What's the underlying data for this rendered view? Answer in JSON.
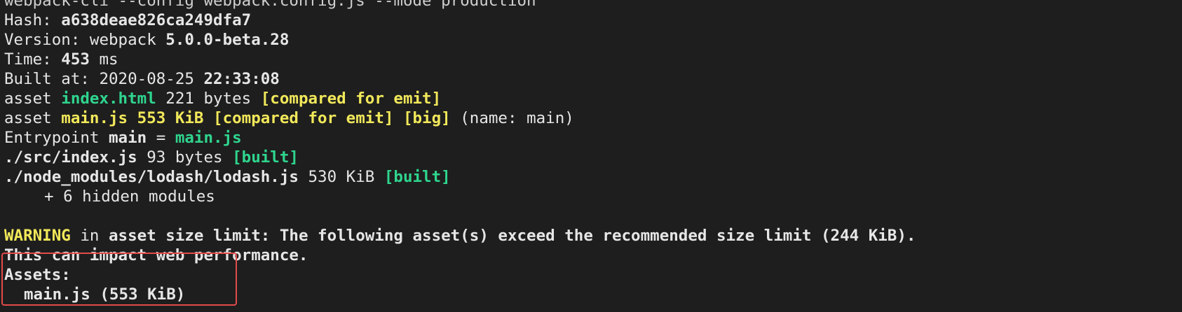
{
  "colors": {
    "background": "#1e1e1e",
    "text": "#e6e6e6",
    "green": "#2fd58e",
    "yellow": "#f1e85a",
    "highlight_border": "#e24b4b"
  },
  "top_partial": "webpack-cli --config webpack.config.js --mode production",
  "hash": {
    "label": "Hash: ",
    "value": "a638deae826ca249dfa7"
  },
  "version": {
    "label": "Version: webpack ",
    "value": "5.0.0-beta.28"
  },
  "time": {
    "label": "Time: ",
    "value": "453",
    "unit": " ms"
  },
  "built_at": {
    "label": "Built at: ",
    "date": "2020-08-25 ",
    "time": "22:33:08"
  },
  "assets_out": [
    {
      "prefix": "asset ",
      "name": "index.html",
      "size": " 221 bytes ",
      "tag": "[compared for emit]"
    },
    {
      "prefix": "asset ",
      "name": "main.js",
      "size": " 553 KiB",
      "tag": " [compared for emit]",
      "tag2": " [big]",
      "suffix": " (name: main)"
    }
  ],
  "entrypoint": {
    "label": "Entrypoint ",
    "name": "main",
    "eq": " = ",
    "file": "main.js"
  },
  "modules": [
    {
      "path": "./src/index.js",
      "size": " 93 bytes ",
      "tag": "[built]"
    },
    {
      "path": "./node_modules/lodash/lodash.js",
      "size": " 530 KiB ",
      "tag": "[built]"
    }
  ],
  "hidden_modules": "+ 6 hidden modules",
  "warning": {
    "label": "WARNING",
    "in": " in ",
    "message": "asset size limit: The following asset(s) exceed the recommended size limit (244 KiB).",
    "line2": "This can impact web performance."
  },
  "assets_section": {
    "heading": "Assets:",
    "item": "main.js (553 KiB)"
  }
}
